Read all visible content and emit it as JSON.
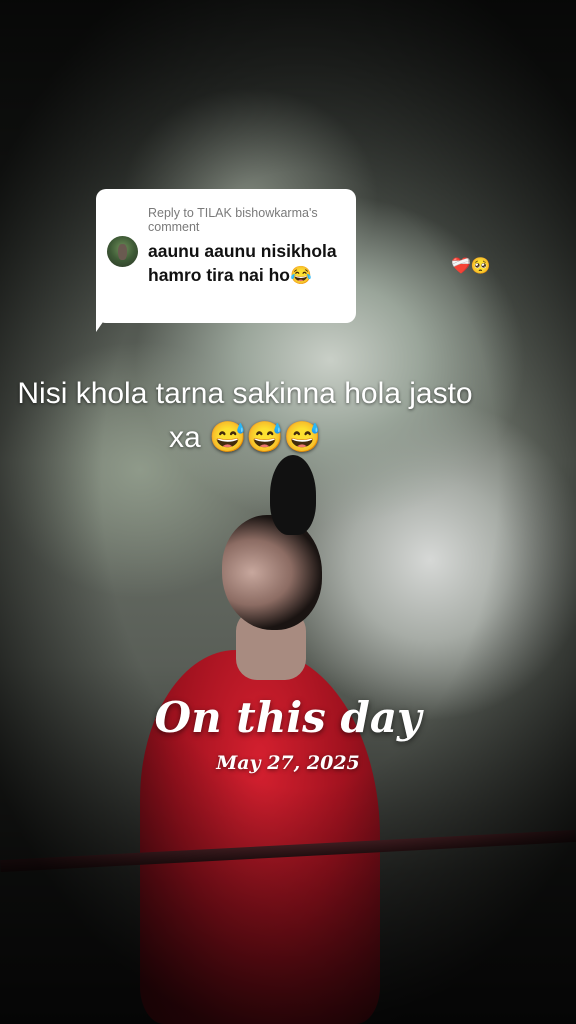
{
  "reply": {
    "header": "Reply to TILAK bishowkarma's comment",
    "body": "aaunu aaunu nisikhola hamro tira nai ho😂"
  },
  "floating_emoji": "❤️‍🩹🥺",
  "caption": "Nisi khola tarna sakinna hola jasto xa 😅😅😅",
  "memory": {
    "title": "On this day",
    "date": "May 27, 2025"
  }
}
